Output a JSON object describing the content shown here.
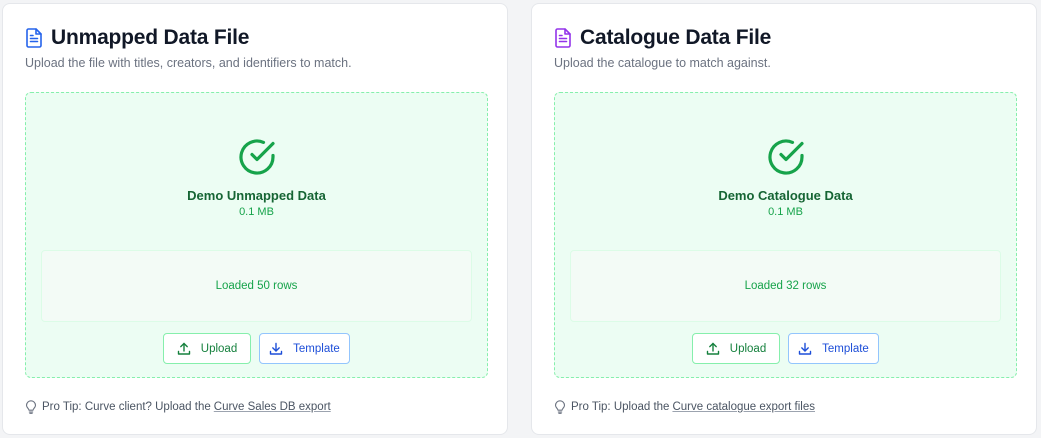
{
  "cards": [
    {
      "title": "Unmapped Data File",
      "subtitle": "Upload the file with titles, creators, and identifiers to match.",
      "icon": "file-text-icon",
      "icon_color": "#2563eb",
      "file_name": "Demo Unmapped Data",
      "file_size": "0.1 MB",
      "status": "Loaded 50 rows",
      "upload_label": "Upload",
      "template_label": "Template",
      "tip_prefix": "Pro Tip: Curve client? Upload the",
      "tip_link": "Curve Sales DB export"
    },
    {
      "title": "Catalogue Data File",
      "subtitle": "Upload the catalogue to match against.",
      "icon": "file-text-icon",
      "icon_color": "#9333ea",
      "file_name": "Demo Catalogue Data",
      "file_size": "0.1 MB",
      "status": "Loaded 32 rows",
      "upload_label": "Upload",
      "template_label": "Template",
      "tip_prefix": "Pro Tip: Upload the",
      "tip_link": "Curve catalogue export files"
    }
  ],
  "colors": {
    "success": "#16a34a",
    "template_accent": "#1d4ed8"
  }
}
